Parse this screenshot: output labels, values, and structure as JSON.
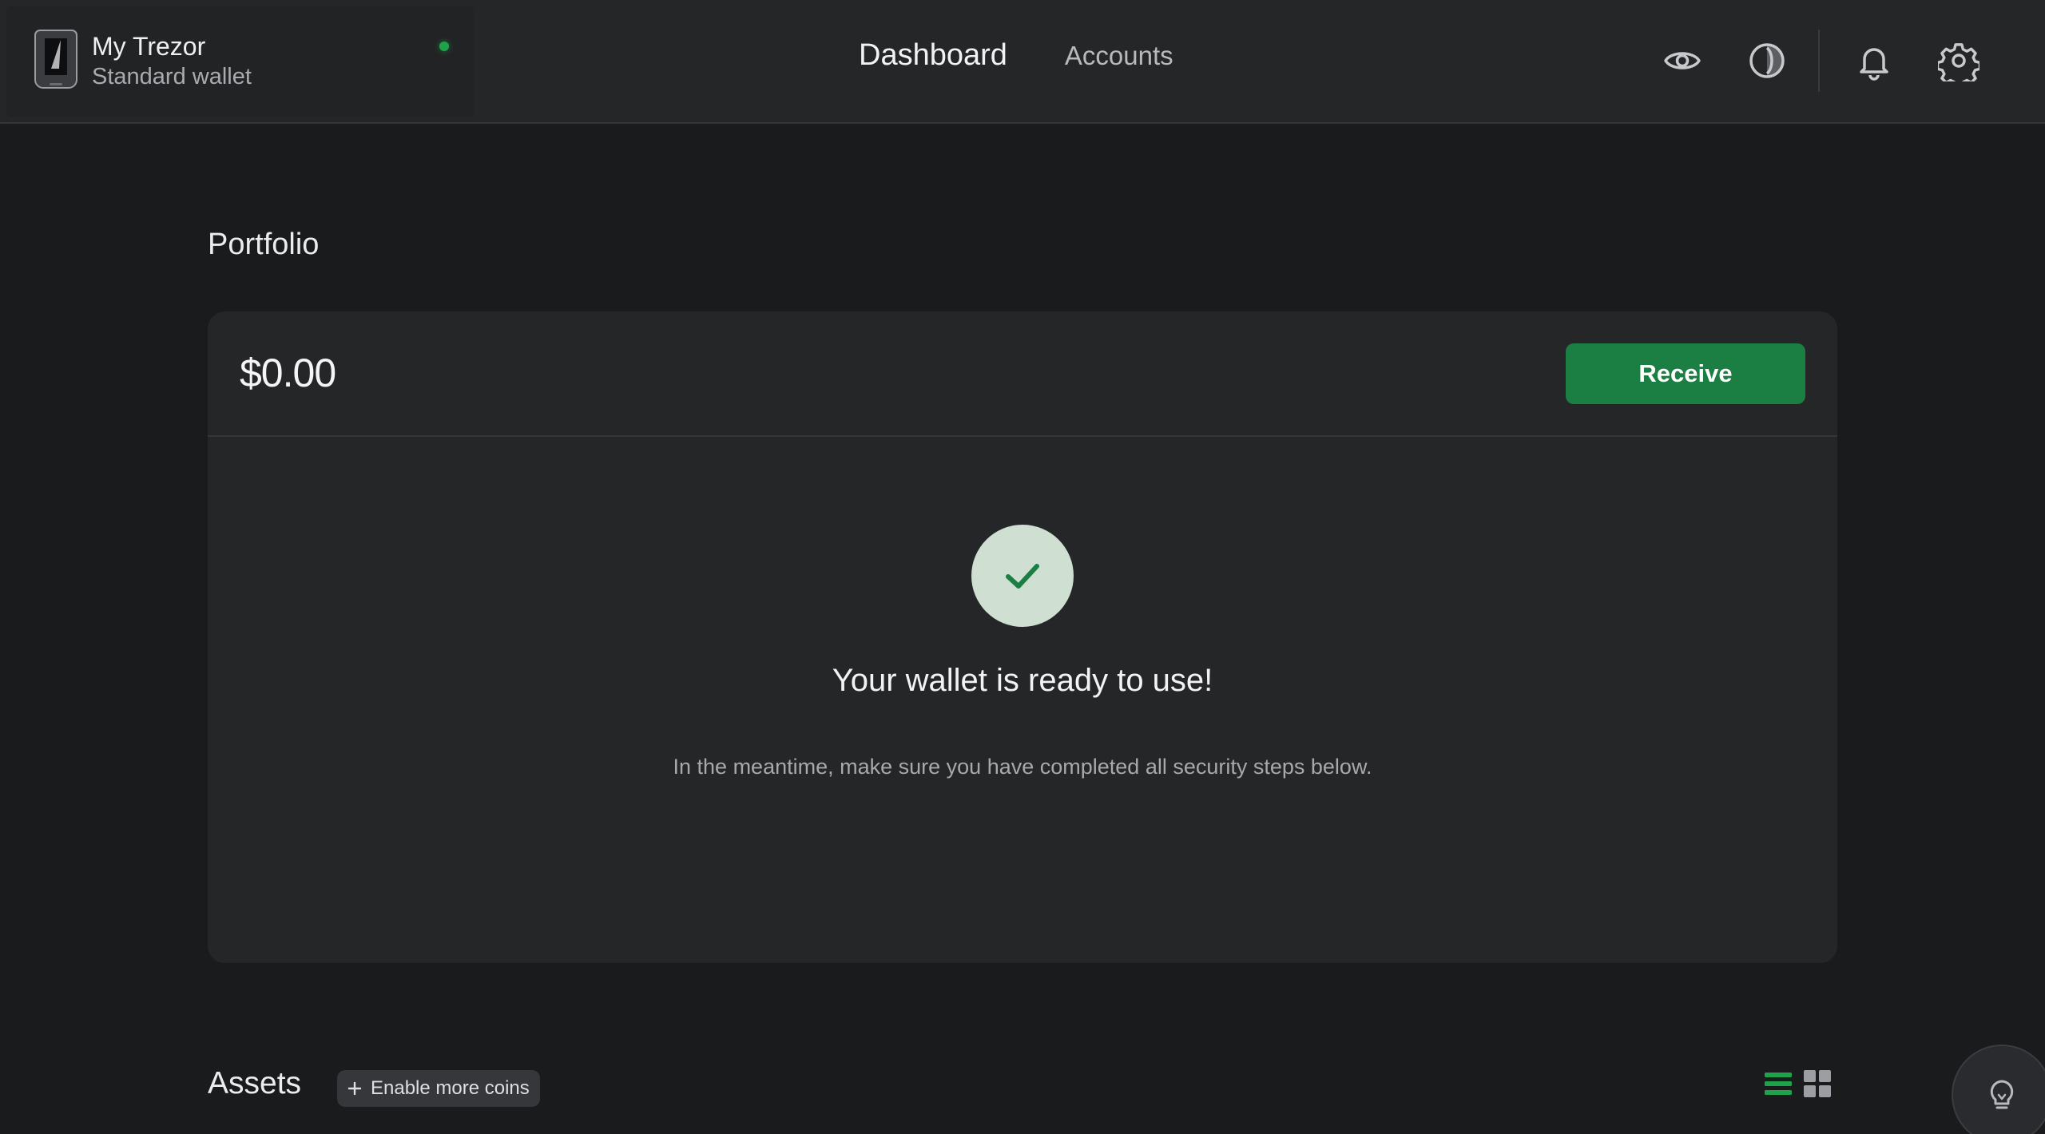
{
  "device": {
    "name": "My Trezor",
    "wallet_type": "Standard wallet",
    "status_color": "#1fa34a"
  },
  "nav": {
    "dashboard": "Dashboard",
    "accounts": "Accounts"
  },
  "header_icons": [
    "eye-icon",
    "theme-contrast-icon",
    "bell-icon",
    "gear-icon"
  ],
  "portfolio": {
    "title": "Portfolio",
    "balance": "$0.00",
    "receive_label": "Receive",
    "ready_title": "Your wallet is ready to use!",
    "ready_subtitle": "In the meantime, make sure you have completed all security steps below."
  },
  "assets": {
    "title": "Assets",
    "enable_coins_label": "Enable more coins",
    "view_mode": "list"
  },
  "colors": {
    "accent": "#1b7e43",
    "background": "#1a1b1d",
    "card": "#252628"
  }
}
